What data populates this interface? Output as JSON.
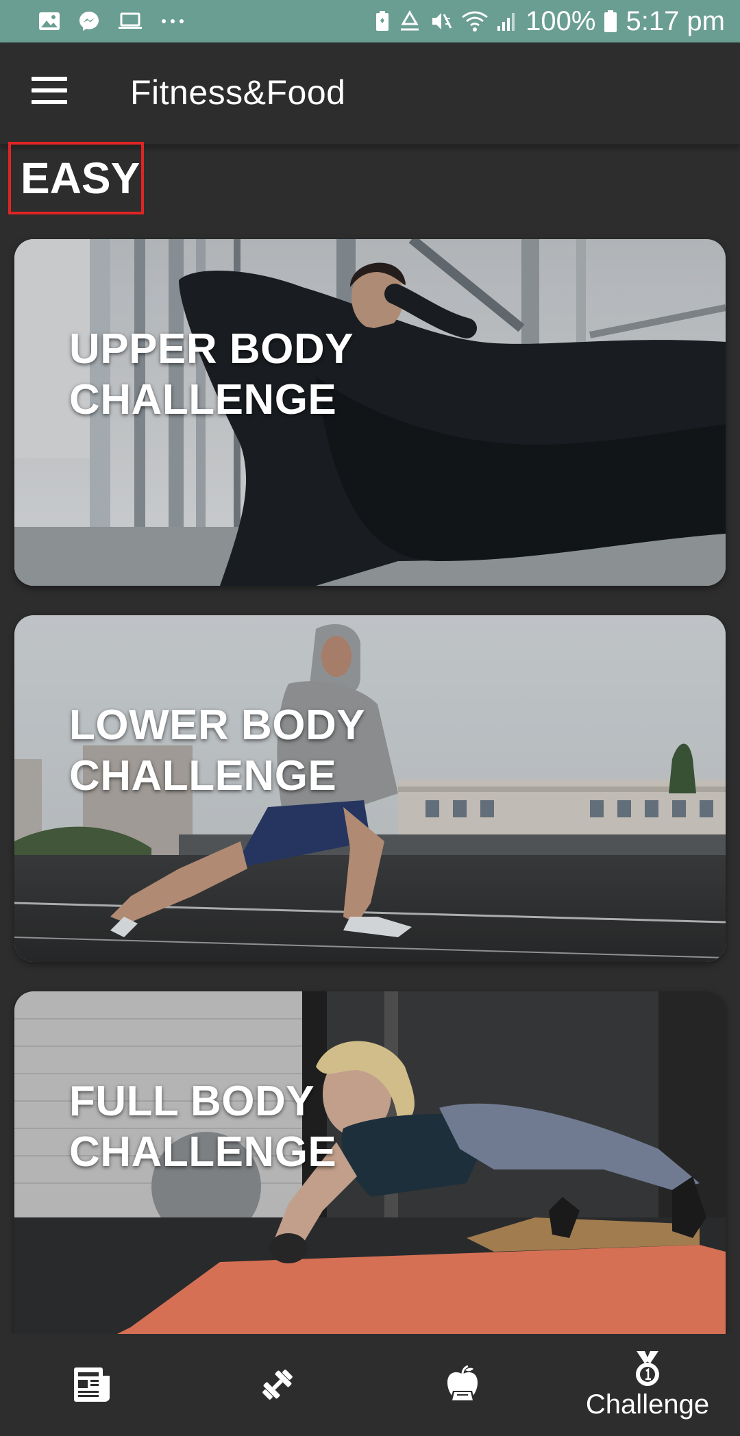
{
  "status_bar": {
    "battery_percent": "100%",
    "time": "5:17 pm",
    "left_icons": [
      "gallery-icon",
      "messenger-icon",
      "laptop-icon",
      "more-icon"
    ],
    "right_icons": [
      "battery-saver-icon",
      "recycle-icon",
      "mute-icon",
      "wifi-icon",
      "signal-icon",
      "battery-icon"
    ]
  },
  "app_bar": {
    "title": "Fitness&Food",
    "menu_icon": "hamburger-menu-icon"
  },
  "level": {
    "label": "EASY"
  },
  "challenges": [
    {
      "line1": "UPPER BODY",
      "line2": "CHALLENGE"
    },
    {
      "line1": "LOWER BODY",
      "line2": "CHALLENGE"
    },
    {
      "line1": "FULL BODY",
      "line2": "CHALLENGE"
    }
  ],
  "bottom_nav": {
    "items": [
      {
        "icon": "newspaper-icon",
        "label": ""
      },
      {
        "icon": "dumbbell-icon",
        "label": ""
      },
      {
        "icon": "apple-scale-icon",
        "label": ""
      },
      {
        "icon": "medal-icon",
        "label": "Challenge"
      }
    ],
    "active_index": 3
  },
  "colors": {
    "status_bar_bg": "#6b9e92",
    "app_bg": "#2d2d2d",
    "highlight_border": "#e02424"
  }
}
